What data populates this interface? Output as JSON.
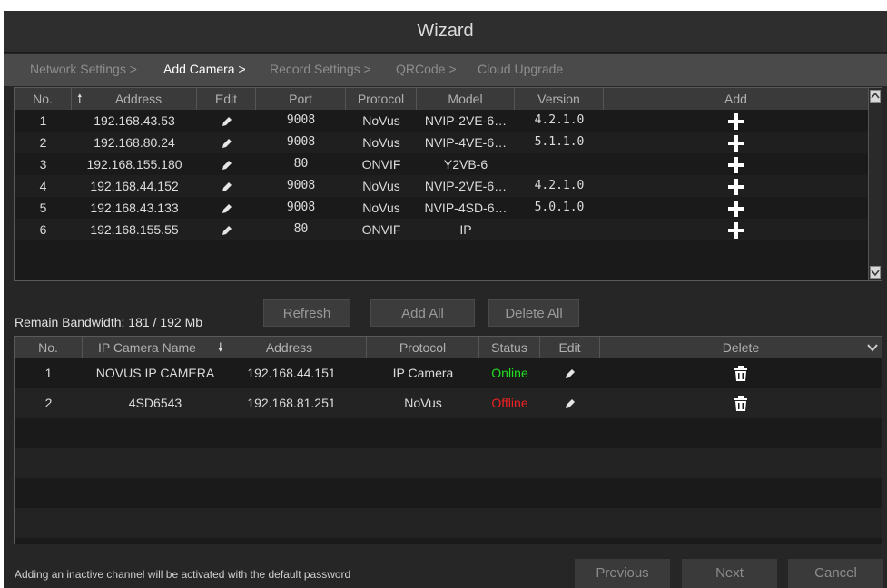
{
  "window": {
    "title": "Wizard"
  },
  "steps": [
    {
      "label": "Network Settings >",
      "active": false
    },
    {
      "label": "Add Camera >",
      "active": true
    },
    {
      "label": "Record Settings >",
      "active": false
    },
    {
      "label": "QRCode >",
      "active": false
    },
    {
      "label": "Cloud Upgrade",
      "active": false
    }
  ],
  "search_table": {
    "columns": {
      "no": "No.",
      "address": "Address",
      "edit": "Edit",
      "port": "Port",
      "protocol": "Protocol",
      "model": "Model",
      "version": "Version",
      "add": "Add"
    },
    "rows": [
      {
        "no": "1",
        "address": "192.168.43.53",
        "port": "9008",
        "protocol": "NoVus",
        "model": "NVIP-2VE-6…",
        "version": "4.2.1.0"
      },
      {
        "no": "2",
        "address": "192.168.80.24",
        "port": "9008",
        "protocol": "NoVus",
        "model": "NVIP-4VE-6…",
        "version": "5.1.1.0"
      },
      {
        "no": "3",
        "address": "192.168.155.180",
        "port": "80",
        "protocol": "ONVIF",
        "model": "Y2VB-6",
        "version": ""
      },
      {
        "no": "4",
        "address": "192.168.44.152",
        "port": "9008",
        "protocol": "NoVus",
        "model": "NVIP-2VE-6…",
        "version": "4.2.1.0"
      },
      {
        "no": "5",
        "address": "192.168.43.133",
        "port": "9008",
        "protocol": "NoVus",
        "model": "NVIP-4SD-6…",
        "version": "5.0.1.0"
      },
      {
        "no": "6",
        "address": "192.168.155.55",
        "port": "80",
        "protocol": "ONVIF",
        "model": "IP",
        "version": ""
      }
    ]
  },
  "bandwidth": "Remain Bandwidth: 181 / 192 Mb",
  "actions": {
    "refresh": "Refresh",
    "add_all": "Add All",
    "delete_all": "Delete All"
  },
  "added_table": {
    "columns": {
      "no": "No.",
      "name": "IP Camera Name",
      "address": "Address",
      "protocol": "Protocol",
      "status": "Status",
      "edit": "Edit",
      "delete": "Delete"
    },
    "rows": [
      {
        "no": "1",
        "name": "NOVUS IP CAMERA",
        "address": "192.168.44.151",
        "protocol": "IP Camera",
        "status": "Online"
      },
      {
        "no": "2",
        "name": "4SD6543",
        "address": "192.168.81.251",
        "protocol": "NoVus",
        "status": "Offline"
      }
    ]
  },
  "footer": {
    "note": "Adding an inactive channel will be activated with the default password",
    "previous": "Previous",
    "next": "Next",
    "cancel": "Cancel"
  },
  "colors": {
    "online": "#22dd22",
    "offline": "#ee2222",
    "background": "#262626"
  }
}
